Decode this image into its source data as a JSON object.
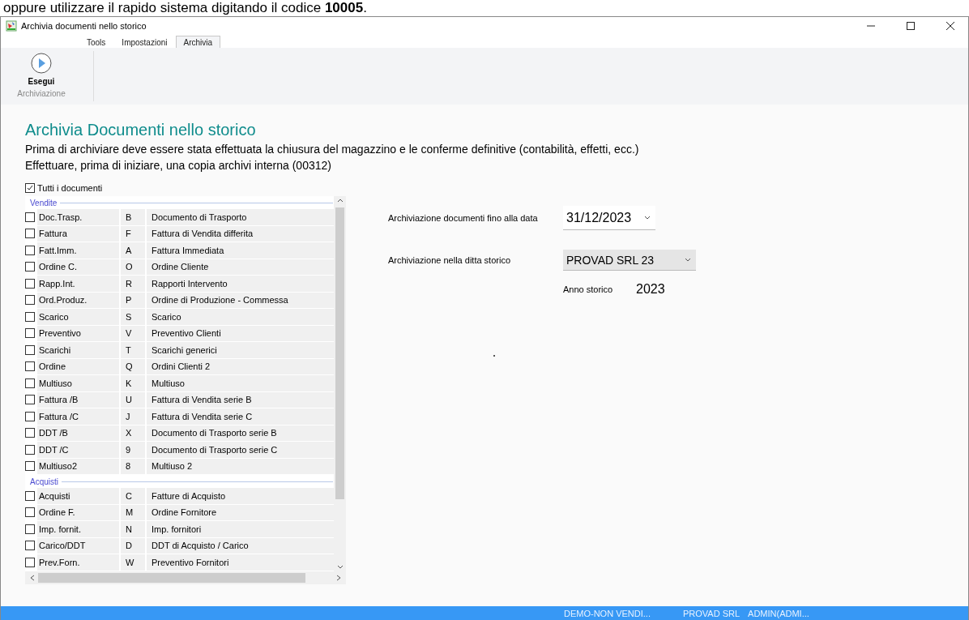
{
  "background_text": "oppure utilizzare il rapido sistema digitando il codice **10005**.",
  "window": {
    "title": "Archivia documenti nello storico"
  },
  "tabs": [
    {
      "label": "Tools",
      "selected": false
    },
    {
      "label": "Impostazioni",
      "selected": false
    },
    {
      "label": "Archivia",
      "selected": true
    }
  ],
  "ribbon": {
    "button": "Esegui",
    "group": "Archiviazione"
  },
  "heading": "Archivia Documenti nello storico",
  "notes": [
    "Prima di archiviare deve essere stata effettuata la chiusura del magazzino e le conferme definitive (contabilità, effetti, ecc.)",
    "Effettuare, prima di iniziare, una copia archivi interna (00312)"
  ],
  "all_documents": {
    "label": "Tutti i documenti",
    "checked": true
  },
  "groups": [
    {
      "title": "Vendite",
      "rows": [
        {
          "name": "Doc.Trasp.",
          "code": "B",
          "description": "Documento di Trasporto",
          "checked": false
        },
        {
          "name": "Fattura",
          "code": "F",
          "description": "Fattura di Vendita differita",
          "checked": false
        },
        {
          "name": "Fatt.Imm.",
          "code": "A",
          "description": "Fattura Immediata",
          "checked": false
        },
        {
          "name": "Ordine C.",
          "code": "O",
          "description": "Ordine Cliente",
          "checked": false
        },
        {
          "name": "Rapp.Int.",
          "code": "R",
          "description": "Rapporti Intervento",
          "checked": false
        },
        {
          "name": "Ord.Produz.",
          "code": "P",
          "description": "Ordine di Produzione - Commessa",
          "checked": false
        },
        {
          "name": "Scarico",
          "code": "S",
          "description": "Scarico",
          "checked": false
        },
        {
          "name": "Preventivo",
          "code": "V",
          "description": "Preventivo Clienti",
          "checked": false
        },
        {
          "name": "Scarichi",
          "code": "T",
          "description": "Scarichi generici",
          "checked": false
        },
        {
          "name": "Ordine",
          "code": "Q",
          "description": "Ordini Clienti 2",
          "checked": false
        },
        {
          "name": "Multiuso",
          "code": "K",
          "description": "Multiuso",
          "checked": false
        },
        {
          "name": "Fattura /B",
          "code": "U",
          "description": "Fattura di Vendita serie B",
          "checked": false
        },
        {
          "name": "Fattura /C",
          "code": "J",
          "description": "Fattura di Vendita serie C",
          "checked": false
        },
        {
          "name": "DDT /B",
          "code": "X",
          "description": "Documento di Trasporto serie B",
          "checked": false
        },
        {
          "name": "DDT /C",
          "code": "9",
          "description": "Documento di Trasporto serie C",
          "checked": false
        },
        {
          "name": "Multiuso2",
          "code": "8",
          "description": "Multiuso 2",
          "checked": false
        }
      ]
    },
    {
      "title": "Acquisti",
      "rows": [
        {
          "name": "Acquisti",
          "code": "C",
          "description": "Fatture di Acquisto",
          "checked": false
        },
        {
          "name": "Ordine F.",
          "code": "M",
          "description": "Ordine Fornitore",
          "checked": false
        },
        {
          "name": "Imp. fornit.",
          "code": "N",
          "description": "Imp. fornitori",
          "checked": false
        },
        {
          "name": "Carico/DDT",
          "code": "D",
          "description": "DDT di Acquisto / Carico",
          "checked": false
        },
        {
          "name": "Prev.Forn.",
          "code": "W",
          "description": "Preventivo Fornitori",
          "checked": false
        }
      ]
    }
  ],
  "form": {
    "date_label": "Archiviazione documenti fino alla data",
    "date_value": "31/12/2023",
    "company_label": "Archiviazione nella ditta storico",
    "company_value": "PROVAD SRL 23",
    "year_label": "Anno storico",
    "year_value": "2023"
  },
  "status_bar": [
    "DEMO-NON VENDI...",
    "PROVAD SRL",
    "ADMIN(ADMI..."
  ]
}
